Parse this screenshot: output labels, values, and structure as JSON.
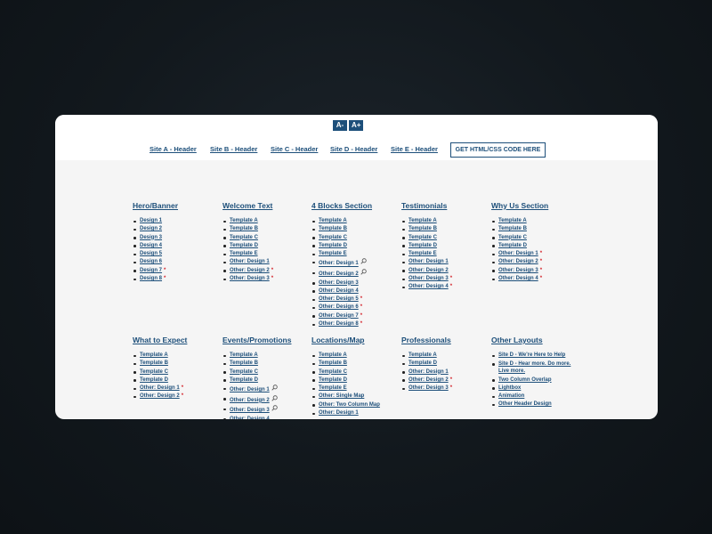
{
  "toolbar": {
    "font_decrease": "A-",
    "font_increase": "A+"
  },
  "nav": {
    "links": [
      "Site A - Header",
      "Site B - Header",
      "Site C - Header",
      "Site D - Header",
      "Site E - Header"
    ],
    "cta": "GET HTML/CSS CODE HERE"
  },
  "colors": {
    "link": "#1d4f7a",
    "star": "#d3232a",
    "card": "#f5f5f5",
    "backdrop": "#12181d"
  },
  "sections": [
    {
      "title": "Hero/Banner",
      "items": [
        {
          "label": "Design 1"
        },
        {
          "label": "Design 2"
        },
        {
          "label": "Design 3"
        },
        {
          "label": "Design 4"
        },
        {
          "label": "Design 5"
        },
        {
          "label": "Design 6"
        },
        {
          "label": "Design 7",
          "star": true
        },
        {
          "label": "Design 8",
          "star": true
        }
      ]
    },
    {
      "title": "Welcome Text",
      "items": [
        {
          "label": "Template A"
        },
        {
          "label": "Template B"
        },
        {
          "label": "Template C"
        },
        {
          "label": "Template D"
        },
        {
          "label": "Template E"
        },
        {
          "label": "Other: Design 1"
        },
        {
          "label": "Other: Design 2",
          "star": true
        },
        {
          "label": "Other: Design 3",
          "star": true
        }
      ]
    },
    {
      "title": "4 Blocks Section",
      "items": [
        {
          "label": "Template A"
        },
        {
          "label": "Template B"
        },
        {
          "label": "Template C"
        },
        {
          "label": "Template D"
        },
        {
          "label": "Template E"
        },
        {
          "label": "Other: Design 1",
          "search": true
        },
        {
          "label": "Other: Design 2",
          "search": true
        },
        {
          "label": "Other: Design 3"
        },
        {
          "label": "Other: Design 4"
        },
        {
          "label": "Other: Design 5",
          "star": true
        },
        {
          "label": "Other: Design 6",
          "star": true
        },
        {
          "label": "Other: Design 7",
          "star": true
        },
        {
          "label": "Other: Design 8",
          "star": true
        }
      ]
    },
    {
      "title": "Testimonials",
      "items": [
        {
          "label": "Template A"
        },
        {
          "label": "Template B"
        },
        {
          "label": "Template C"
        },
        {
          "label": "Template D"
        },
        {
          "label": "Template E"
        },
        {
          "label": "Other: Design 1"
        },
        {
          "label": "Other: Design 2"
        },
        {
          "label": "Other: Design 3",
          "star": true
        },
        {
          "label": "Other: Design 4",
          "star": true
        }
      ]
    },
    {
      "title": "Why Us Section",
      "items": [
        {
          "label": "Template A"
        },
        {
          "label": "Template B"
        },
        {
          "label": "Template C"
        },
        {
          "label": "Template D"
        },
        {
          "label": "Other: Design 1",
          "star": true
        },
        {
          "label": "Other: Design 2",
          "star": true
        },
        {
          "label": "Other: Design 3",
          "star": true
        },
        {
          "label": "Other: Design 4",
          "star": true
        }
      ]
    },
    {
      "title": "What to Expect",
      "items": [
        {
          "label": "Template A"
        },
        {
          "label": "Template B"
        },
        {
          "label": "Template C"
        },
        {
          "label": "Template D"
        },
        {
          "label": "Other: Design 1",
          "star": true
        },
        {
          "label": "Other: Design 2",
          "star": true
        }
      ]
    },
    {
      "title": "Events/Promotions",
      "items": [
        {
          "label": "Template A"
        },
        {
          "label": "Template B"
        },
        {
          "label": "Template C"
        },
        {
          "label": "Template D"
        },
        {
          "label": "Other: Design 1",
          "search": true
        },
        {
          "label": "Other: Design 2",
          "search": true
        },
        {
          "label": "Other: Design 3",
          "search": true
        },
        {
          "label": "Other: Design 4"
        }
      ]
    },
    {
      "title": "Locations/Map",
      "items": [
        {
          "label": "Template A"
        },
        {
          "label": "Template B"
        },
        {
          "label": "Template C"
        },
        {
          "label": "Template D"
        },
        {
          "label": "Template E"
        },
        {
          "label": "Other: Single Map"
        },
        {
          "label": "Other: Two Column Map"
        },
        {
          "label": "Other: Design 1"
        }
      ]
    },
    {
      "title": "Professionals",
      "items": [
        {
          "label": "Template A"
        },
        {
          "label": "Template D"
        },
        {
          "label": "Other: Design 1"
        },
        {
          "label": "Other: Design 2",
          "star": true
        },
        {
          "label": "Other: Design 3",
          "star": true
        }
      ]
    },
    {
      "title": "Other Layouts",
      "items": [
        {
          "label": "Site D - We're Here to Help"
        },
        {
          "label": "Site D - Hear more. Do more. Live more."
        },
        {
          "label": "Two Column Overlap"
        },
        {
          "label": "Lightbox"
        },
        {
          "label": "Animation"
        },
        {
          "label": "Other Header Design"
        }
      ]
    }
  ]
}
